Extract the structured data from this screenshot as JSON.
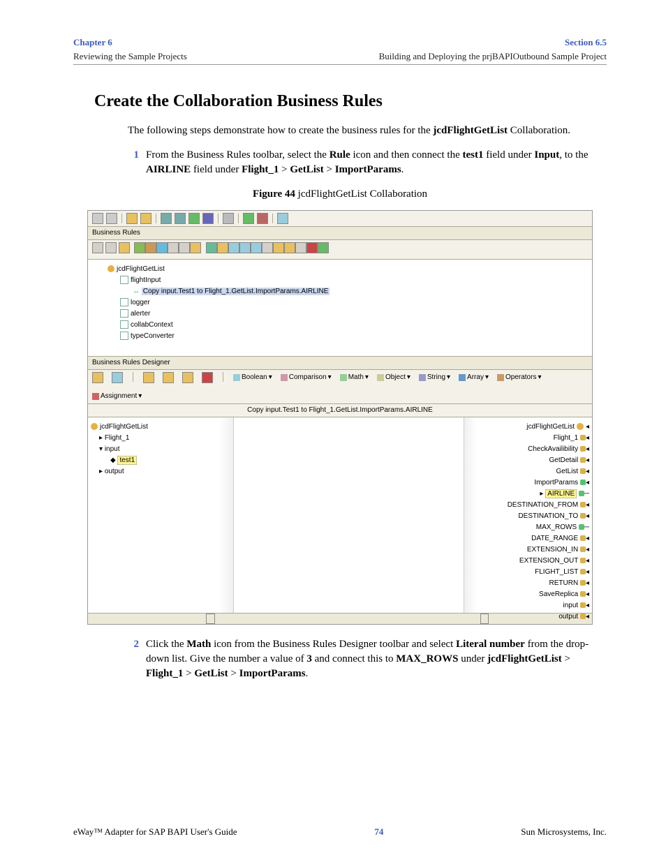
{
  "header": {
    "chapter_link": "Chapter 6",
    "chapter_sub": "Reviewing the Sample Projects",
    "section_link": "Section 6.5",
    "section_sub": "Building and Deploying the prjBAPIOutbound Sample Project"
  },
  "h2": "Create the Collaboration Business Rules",
  "intro1": "The following steps demonstrate how to create the business rules for the ",
  "intro_bold": "jcdFlightGetList",
  "intro2": " Collaboration.",
  "step1": {
    "num": "1",
    "a": "From the Business Rules toolbar, select the ",
    "b": "Rule",
    "c": " icon and then connect the ",
    "d": "test1",
    "e": " field under ",
    "f": "Input",
    "g": ", to the ",
    "h": "AIRLINE",
    "i": " field under ",
    "j": "Flight_1",
    "k": " > ",
    "l": "GetList",
    "m": " > ",
    "n": "ImportParams",
    "o": "."
  },
  "fig": {
    "label": "Figure 44",
    "caption": "   jcdFlightGetList Collaboration"
  },
  "ui": {
    "pane1_title": "Business Rules",
    "tree": {
      "root": "jcdFlightGetList",
      "flight": "flightInput",
      "copy": "Copy input.Test1 to Flight_1.GetList.ImportParams.AIRLINE",
      "logger": "logger",
      "alerter": "alerter",
      "collab": "collabContext",
      "typeconv": "typeConverter"
    },
    "pane2_title": "Business Rules Designer",
    "menu": {
      "b": "Boolean",
      "c": "Comparison",
      "m": "Math",
      "o": "Object",
      "s": "String",
      "a": "Array",
      "op": "Operators",
      "as": "Assignment"
    },
    "subtitle": "Copy input.Test1 to Flight_1.GetList.ImportParams.AIRLINE",
    "left": {
      "root": "jcdFlightGetList",
      "f": "Flight_1",
      "i": "input",
      "t": "test1",
      "o": "output"
    },
    "right": {
      "r1": "jcdFlightGetList",
      "r2": "Flight_1",
      "r3": "CheckAvailibility",
      "r4": "GetDetail",
      "r5": "GetList",
      "r6": "ImportParams",
      "r7": "AIRLINE",
      "r8": "DESTINATION_FROM",
      "r9": "DESTINATION_TO",
      "r10": "MAX_ROWS",
      "r11": "DATE_RANGE",
      "r12": "EXTENSION_IN",
      "r13": "EXTENSION_OUT",
      "r14": "FLIGHT_LIST",
      "r15": "RETURN",
      "r16": "SaveReplica",
      "r17": "input",
      "r18": "output"
    }
  },
  "step2": {
    "num": "2",
    "a": "Click the ",
    "b": "Math",
    "c": " icon from the Business Rules Designer toolbar and select ",
    "d": "Literal number",
    "e": " from the drop-down list. Give the number a value of ",
    "f": "3",
    "g": " and connect this to ",
    "h": "MAX_ROWS",
    "i": " under ",
    "j": "jcdFlightGetList",
    "k": " > ",
    "l": "Flight_1",
    "m": " > ",
    "n": "GetList",
    "o": " > ",
    "p": "ImportParams",
    "q": "."
  },
  "footer": {
    "left": "eWay™ Adapter for SAP BAPI User's Guide",
    "page": "74",
    "right": "Sun Microsystems, Inc."
  }
}
